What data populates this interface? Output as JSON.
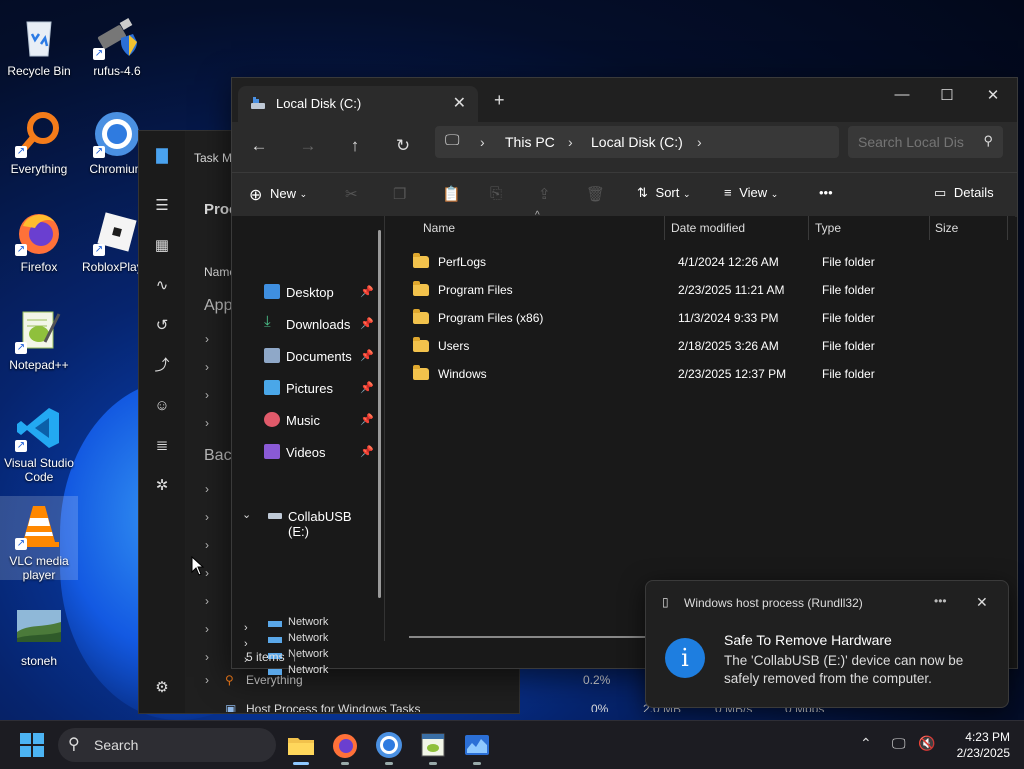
{
  "desktop": {
    "icons": [
      {
        "label": "Recycle Bin"
      },
      {
        "label": "rufus-4.6"
      },
      {
        "label": "Everything"
      },
      {
        "label": "Chromium"
      },
      {
        "label": "Firefox"
      },
      {
        "label": "RobloxPlayer"
      },
      {
        "label": "Notepad++"
      },
      {
        "label": "Visual Studio Code"
      },
      {
        "label": "VLC media player"
      },
      {
        "label": "stoneh"
      }
    ]
  },
  "taskmgr": {
    "title": "Task M",
    "header": "Proc",
    "col_name": "Name",
    "section_apps": "App",
    "section_background": "Back",
    "rows": [
      {
        "name": "Everything",
        "cpu": "0.2%",
        "mem": "",
        "disk": "",
        "net": ""
      },
      {
        "name": "Host Process for Windows Tasks",
        "cpu": "0%",
        "mem": "2.0 MB",
        "disk": "0 MB/s",
        "net": "0 Mbps"
      }
    ]
  },
  "explorer": {
    "tab_title": "Local Disk (C:)",
    "breadcrumb": [
      "This PC",
      "Local Disk (C:)"
    ],
    "search_placeholder": "Search Local Dis",
    "toolbar": {
      "new": "New",
      "sort": "Sort",
      "view": "View",
      "more": "•••",
      "details": "Details"
    },
    "sidebar": {
      "quick": [
        {
          "label": "Desktop",
          "color": "#3f8fe0"
        },
        {
          "label": "Downloads",
          "color": "#4cc38a"
        },
        {
          "label": "Documents",
          "color": "#8fa8c8"
        },
        {
          "label": "Pictures",
          "color": "#4aa7e8"
        },
        {
          "label": "Music",
          "color": "#e05a6a"
        },
        {
          "label": "Videos",
          "color": "#8a5ad6"
        }
      ],
      "usb": "CollabUSB (E:)",
      "network": [
        "Network",
        "Network",
        "Network",
        "Network"
      ]
    },
    "columns": {
      "name": "Name",
      "date": "Date modified",
      "type": "Type",
      "size": "Size"
    },
    "files": [
      {
        "name": "PerfLogs",
        "date": "4/1/2024 12:26 AM",
        "type": "File folder"
      },
      {
        "name": "Program Files",
        "date": "2/23/2025 11:21 AM",
        "type": "File folder"
      },
      {
        "name": "Program Files (x86)",
        "date": "11/3/2024 9:33 PM",
        "type": "File folder"
      },
      {
        "name": "Users",
        "date": "2/18/2025 3:26 AM",
        "type": "File folder"
      },
      {
        "name": "Windows",
        "date": "2/23/2025 12:37 PM",
        "type": "File folder"
      }
    ],
    "status": "5 items"
  },
  "toast": {
    "app": "Windows host process (Rundll32)",
    "more": "•••",
    "title": "Safe To Remove Hardware",
    "body": "The 'CollabUSB (E:)' device can now be safely removed from the computer."
  },
  "taskbar": {
    "search": "Search",
    "time": "4:23 PM",
    "date": "2/23/2025"
  },
  "colors": {
    "accent": "#0078d4",
    "folder": "#f2c24c",
    "toast_info": "#1e7ee0"
  }
}
